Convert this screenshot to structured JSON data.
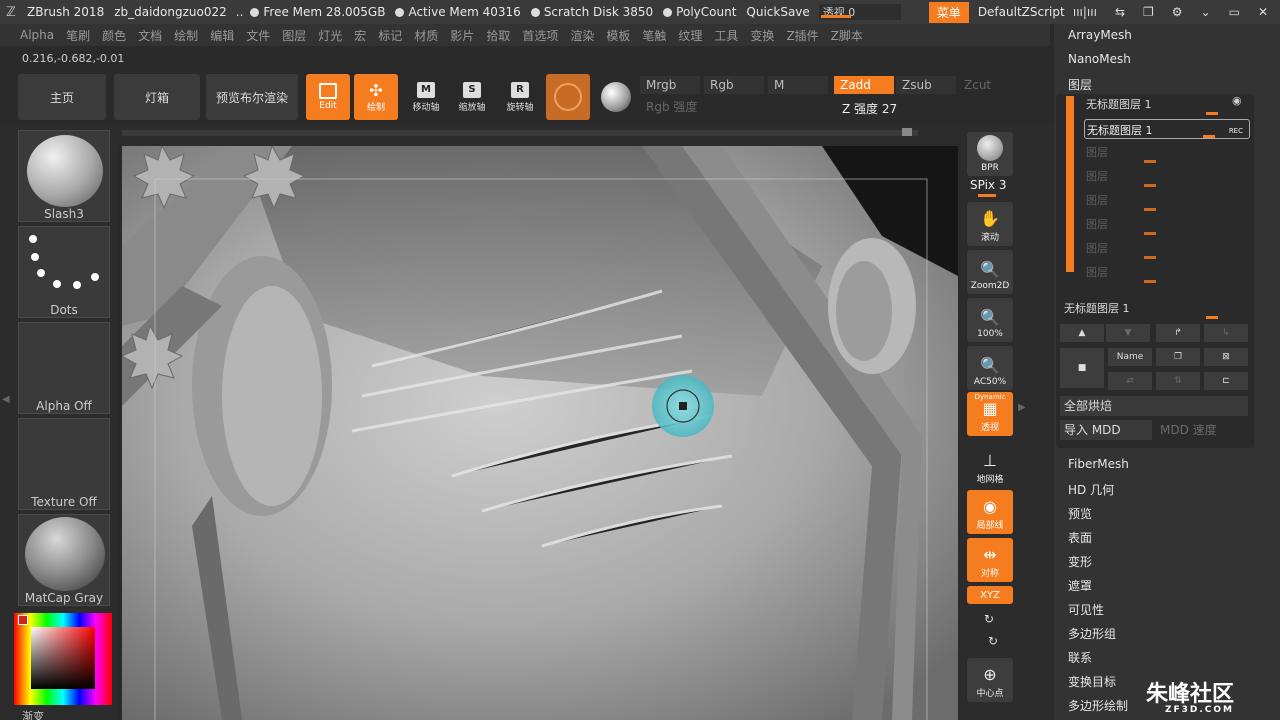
{
  "title": {
    "app": "ZBrush 2018",
    "file": "zb_daidongzuo022",
    "sep": "..",
    "free_mem": "Free Mem 28.005GB",
    "active_mem": "Active Mem 40316",
    "scratch": "Scratch Disk 3850",
    "polycount": "PolyCount",
    "quicksave": "QuickSave",
    "perspective_label": "透视",
    "perspective_value": "0",
    "menu_btn": "菜单",
    "default_script": "DefaultZScript"
  },
  "menubar": [
    "Alpha",
    "笔刷",
    "颜色",
    "文档",
    "绘制",
    "编辑",
    "文件",
    "图层",
    "灯光",
    "宏",
    "标记",
    "材质",
    "影片",
    "拾取",
    "首选项",
    "渲染",
    "模板",
    "笔触",
    "纹理",
    "工具",
    "变换",
    "Z插件",
    "Z脚本"
  ],
  "coords": "0.216,-0.682,-0.01",
  "shelf": {
    "home": "主页",
    "lightbox": "灯箱",
    "bpr": "预览布尔渲染",
    "edit": "Edit",
    "draw": "绘制",
    "move": "移动轴",
    "scale": "缩放轴",
    "rotate": "旋转轴",
    "mrgb": "Mrgb",
    "rgb": "Rgb",
    "m": "M",
    "rgb_intensity": "Rgb 强度",
    "zadd": "Zadd",
    "zsub": "Zsub",
    "zcut": "Zcut",
    "z_intensity": "Z 强度 27"
  },
  "left": {
    "brush": "Slash3",
    "stroke": "Dots",
    "alpha": "Alpha Off",
    "texture": "Texture Off",
    "material": "MatCap Gray",
    "gradient": "渐变"
  },
  "rightdock": {
    "bpr": "BPR",
    "spix": "SPix 3",
    "scroll": "滚动",
    "zoom2d": "Zoom2D",
    "actual": "100%",
    "ac50": "AC50%",
    "dynamic": "Dynamic",
    "persp": "透视",
    "floor": "地网格",
    "local": "局部线",
    "sym": "对称",
    "xyz": "XYZ",
    "center": "中心点"
  },
  "rpanel": {
    "arraymesh": "ArrayMesh",
    "nanomesh": "NanoMesh",
    "layers_title": "图层",
    "layer_active": "无标题图层 1",
    "layer_rec": "无标题图层 1",
    "rec": "REC",
    "empty_layers": [
      "图层",
      "图层",
      "图层",
      "图层",
      "图层",
      "图层"
    ],
    "current_layer": "无标题图层 1",
    "name_btn": "Name",
    "bake_all": "全部烘焙",
    "import_mdd": "导入 MDD",
    "mdd_speed": "MDD 速度",
    "sections": [
      "FiberMesh",
      "HD 几何",
      "预览",
      "表面",
      "变形",
      "遮罩",
      "可见性",
      "多边形组",
      "联系",
      "变换目标",
      "多边形绘制"
    ]
  },
  "watermark": {
    "main": "朱峰社区",
    "sub": "ZF3D.COM"
  }
}
